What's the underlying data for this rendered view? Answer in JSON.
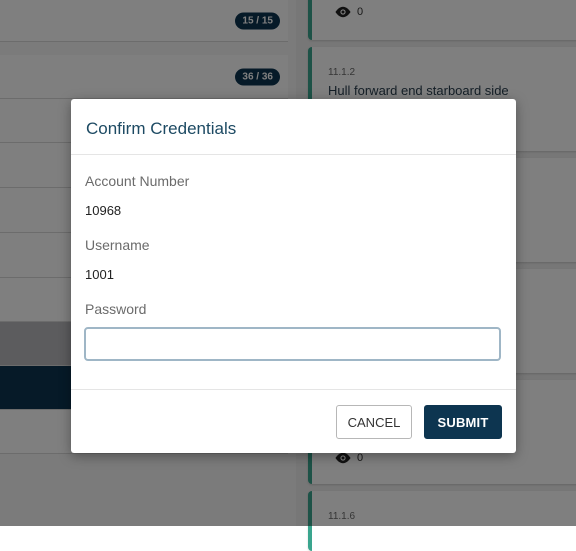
{
  "background": {
    "left_rows": [
      {
        "badge": "15 / 15"
      },
      {
        "badge": "36 / 36"
      },
      {
        "badge": ""
      },
      {
        "badge": ""
      },
      {
        "badge": ""
      },
      {
        "badge": ""
      },
      {
        "badge": ""
      },
      {
        "badge": ""
      },
      {
        "badge": ""
      },
      {
        "badge": ""
      }
    ],
    "cards": [
      {
        "code": "",
        "title": "",
        "eye_count": "0"
      },
      {
        "code": "11.1.2",
        "title": "Hull forward end starboard side",
        "eye_count": ""
      },
      {
        "code": "",
        "title": "",
        "eye_count": "0"
      },
      {
        "code": "11.1.6",
        "title": "",
        "eye_count": ""
      }
    ]
  },
  "modal": {
    "title": "Confirm Credentials",
    "account_label": "Account Number",
    "account_value": "10968",
    "username_label": "Username",
    "username_value": "1001",
    "password_label": "Password",
    "password_value": "",
    "cancel_label": "CANCEL",
    "submit_label": "SUBMIT"
  },
  "colors": {
    "primary": "#0d3550",
    "accent": "#3aa58e",
    "title": "#1d4a63"
  },
  "icons": [
    "eye-icon"
  ]
}
